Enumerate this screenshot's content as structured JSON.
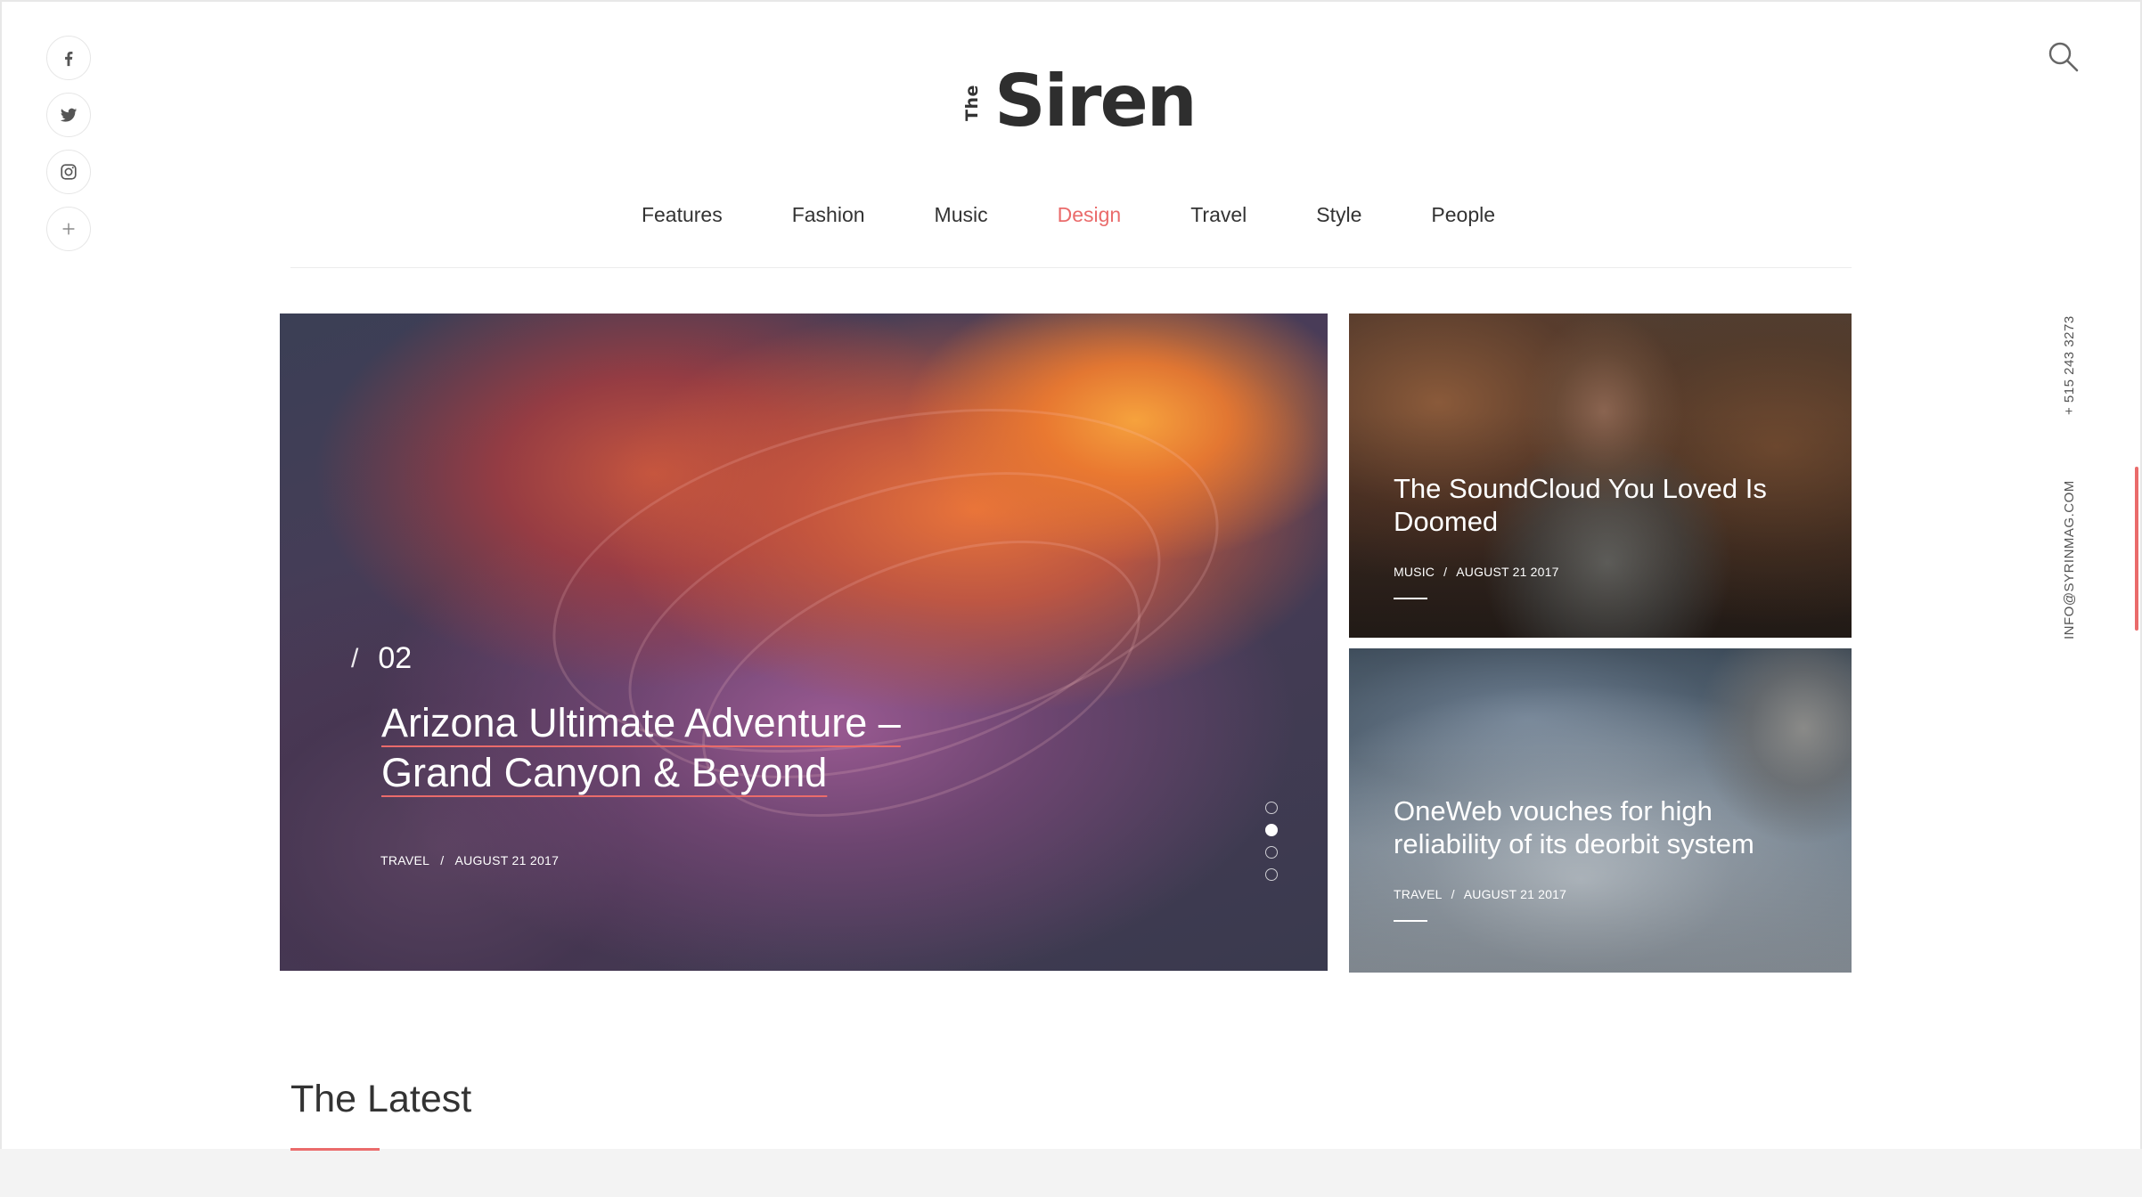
{
  "brand": {
    "prefix": "The",
    "name": "Siren"
  },
  "social": [
    {
      "name": "facebook",
      "icon": "facebook-icon"
    },
    {
      "name": "twitter",
      "icon": "twitter-icon"
    },
    {
      "name": "instagram",
      "icon": "instagram-icon"
    },
    {
      "name": "more",
      "icon": "plus-icon"
    }
  ],
  "nav": {
    "items": [
      "Features",
      "Fashion",
      "Music",
      "Design",
      "Travel",
      "Style",
      "People"
    ],
    "active": "Design"
  },
  "hero": {
    "number": "02",
    "title": "Arizona Ultimate Adventure – Grand Canyon & Beyond",
    "category": "TRAVEL",
    "date": "AUGUST 21 2017",
    "slides_total": 4,
    "active_slide": 2
  },
  "cards": [
    {
      "title": "The SoundCloud You Loved Is Doomed",
      "category": "MUSIC",
      "date": "AUGUST 21 2017"
    },
    {
      "title": "OneWeb vouches for high reliability of its deorbit system",
      "category": "TRAVEL",
      "date": "AUGUST 21 2017"
    }
  ],
  "contact": {
    "phone": "+ 515 243 3273",
    "email": "INFO@SYRINMAG.COM"
  },
  "latest": {
    "heading": "The Latest"
  },
  "colors": {
    "accent": "#ea6b6b",
    "text": "#333333",
    "divider": "#ececec"
  }
}
